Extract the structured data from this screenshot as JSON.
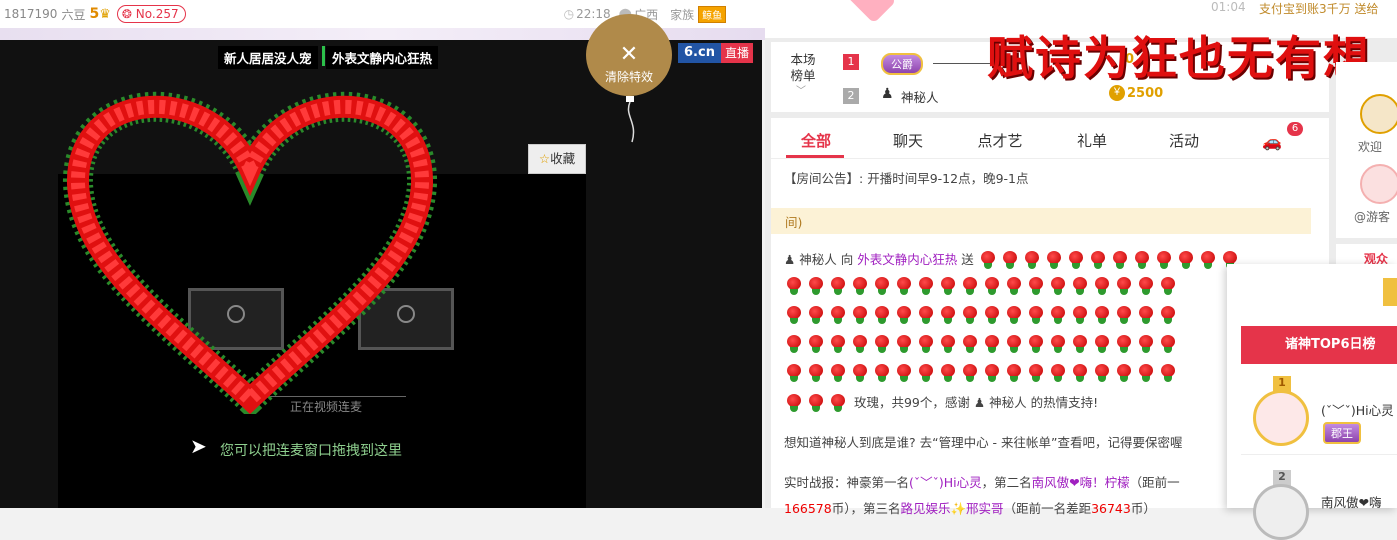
{
  "topbar": {
    "user_id": "1817190",
    "currency": "六豆",
    "level_num": "5",
    "rank_badge": "No.257",
    "time": "22:18",
    "location": "广西",
    "family_label": "家族",
    "family_badge": "鲸鱼"
  },
  "stage": {
    "host_tag_1": "新人居居没人宠",
    "host_tag_2": "外表文静内心狂热",
    "clear_effects_label": "清除特效",
    "brand_logo": "6.cn",
    "live_badge": "直播",
    "favorite_label": "收藏",
    "connecting_label": "正在视频连麦",
    "drag_hint": "您可以把连麦窗口拖拽到这里"
  },
  "right_top": {
    "timer": "01:04",
    "alipay_text": "支付宝到账3千万 送给"
  },
  "ranking": {
    "title": "本场榜单",
    "row1_rank": "1",
    "row1_badge": "公爵",
    "row1_score": "0",
    "row2_rank": "2",
    "row2_name": "神秘人",
    "row2_score": "2500",
    "banner": "赋诗为狂也无有想"
  },
  "tabs": [
    {
      "label": "全部",
      "active": true
    },
    {
      "label": "聊天",
      "active": false
    },
    {
      "label": "点才艺",
      "active": false
    },
    {
      "label": "礼单",
      "active": false
    },
    {
      "label": "活动",
      "active": false
    }
  ],
  "car_badge": "6",
  "chat": {
    "notice_prefix": "【房间公告】:",
    "notice_text": "开播时间早9-12点，晚9-1点",
    "yellow_text": "间)",
    "gift_sender": "神秘人",
    "gift_to": "向",
    "gift_receiver": "外表文静内心狂热",
    "gift_send_word": "送",
    "gift_summary": "玫瑰，共99个，感谢",
    "gift_thanks_name": "神秘人",
    "gift_thanks_tail": "的热情支持!",
    "info_text": "想知道神秘人到底是谁? 去“管理中心 - 来往帐单”查看吧，记得要保密喔",
    "battle_prefix": "实时战报：神豪第一名",
    "battle_first": "(ˇ﹀ˇ)Hi心灵",
    "battle_mid": "，第二名",
    "battle_second": "南风傲❤嗨！柠檬",
    "battle_tail": "（距前一",
    "battle_line2_num": "166578",
    "battle_line2_a": "币），第三名",
    "battle_third": "路见娱乐✨邢实哥",
    "battle_line2_b": "（距前一名差距",
    "battle_line2_num2": "36743",
    "battle_line2_c": "币）"
  },
  "side": {
    "welcome": "欢迎",
    "guest": "@游客",
    "audience": "观众"
  },
  "popup": {
    "top6_title": "诸神TOP6日榜",
    "entry1_rank": "1",
    "entry1_name": "(ˇ﹀ˇ)Hi心灵",
    "entry1_badge": "郡王",
    "entry2_rank": "2",
    "entry2_name": "南风傲❤嗨"
  },
  "colors": {
    "accent": "#e5344a",
    "gold": "#b08a4a",
    "purple": "#a020c0"
  }
}
